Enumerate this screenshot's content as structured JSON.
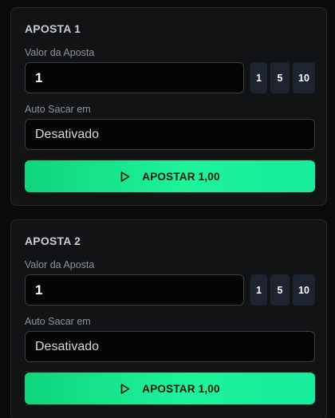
{
  "bets": [
    {
      "title": "APOSTA 1",
      "amount_label": "Valor da Aposta",
      "amount_value": "1",
      "quick_amounts": [
        "1",
        "5",
        "10"
      ],
      "auto_cashout_label": "Auto Sacar em",
      "auto_cashout_value": "Desativado",
      "bet_button_label": "APOSTAR 1,00"
    },
    {
      "title": "APOSTA 2",
      "amount_label": "Valor da Aposta",
      "amount_value": "1",
      "quick_amounts": [
        "1",
        "5",
        "10"
      ],
      "auto_cashout_label": "Auto Sacar em",
      "auto_cashout_value": "Desativado",
      "bet_button_label": "APOSTAR 1,00"
    }
  ],
  "icons": {
    "bet_button": "play-icon"
  },
  "colors": {
    "accent_start": "#0fd47c",
    "accent_end": "#17eb9d",
    "card_bg": "#121315",
    "quick_button_bg": "#1d2430"
  }
}
